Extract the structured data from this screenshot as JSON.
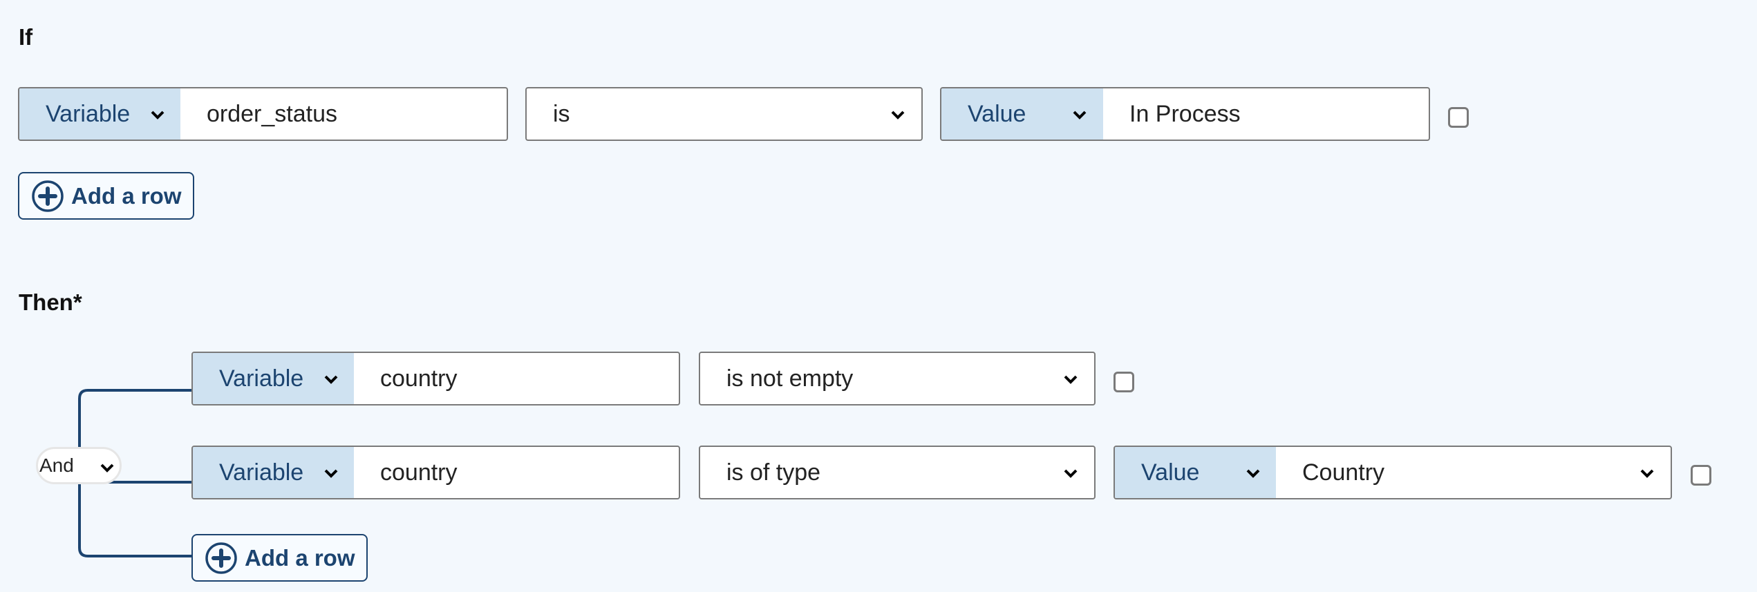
{
  "if_section": {
    "heading": "If",
    "rows": [
      {
        "left_type": "Variable",
        "left_value": "order_status",
        "operator": "is",
        "right_type": "Value",
        "right_value": "In Process",
        "checked": false
      }
    ],
    "add_row_label": "Add a row"
  },
  "then_section": {
    "heading": "Then*",
    "logic_operator": "And",
    "rows": [
      {
        "left_type": "Variable",
        "left_value": "country",
        "operator": "is not empty",
        "checked": false
      },
      {
        "left_type": "Variable",
        "left_value": "country",
        "operator": "is of type",
        "right_type": "Value",
        "right_value": "Country",
        "checked": false
      }
    ],
    "add_row_label": "Add a row"
  },
  "icons": {
    "chevron": "chevron-down-icon",
    "add": "plus-circle-icon"
  },
  "colors": {
    "background": "#f3f8fd",
    "type_bg": "#cfe2f1",
    "accent": "#1c4470",
    "border": "#7a7a7a"
  }
}
